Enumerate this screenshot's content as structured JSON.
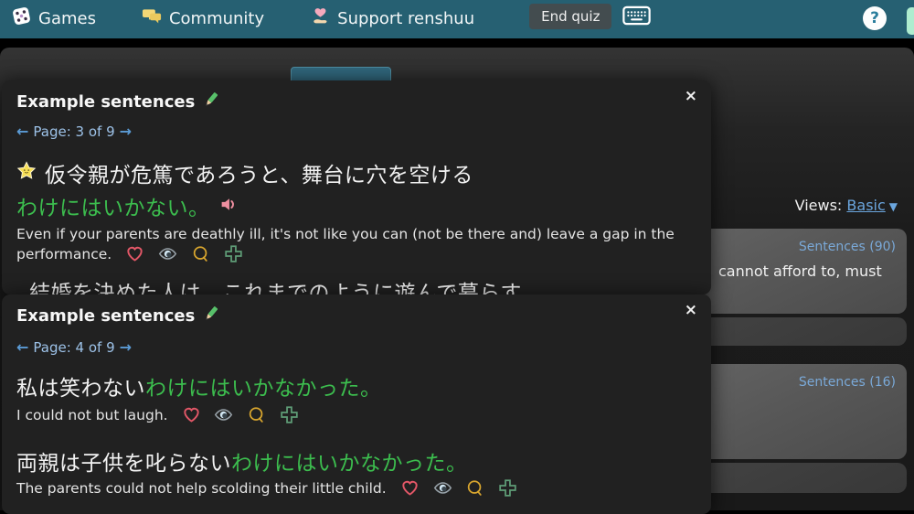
{
  "topbar": {
    "games": "Games",
    "community": "Community",
    "support": "Support renshuu",
    "end_quiz": "End quiz",
    "help": "?"
  },
  "modal1": {
    "title": "Example sentences",
    "close": "×",
    "prev_arrow": "←",
    "next_arrow": "→",
    "page": "Page: 3 of 9",
    "s1_jp_white": "仮令親が危篤であろうと、舞台に穴を空ける",
    "s1_jp_green": "わけにはいかない。",
    "s1_en": "Even if your parents are deathly ill, it's not like you can (not be there and) leave a gap in the performance.",
    "s2_jp_partial": "結婚を決めた人は、これまでのように遊んで暮らす"
  },
  "modal2": {
    "title": "Example sentences",
    "close": "×",
    "prev_arrow": "←",
    "next_arrow": "→",
    "page": "Page: 4 of 9",
    "s1_jp_white": "私は笑わない",
    "s1_jp_green": "わけにはいかなかった。",
    "s1_en": "I could not but laugh.",
    "s2_jp_white": "両親は子供を叱らない",
    "s2_jp_green": "わけにはいかなかった。",
    "s2_en": "The parents could not help scolding their little child."
  },
  "sidebar": {
    "views_label": "Views:",
    "views_value": "Basic",
    "card1_badge": "Sentences (90)",
    "card1_text": "cannot afford to, must",
    "card2_badge": "Sentences (16)"
  },
  "colors": {
    "topbar_teal": "#266072",
    "highlight_green": "#3cbd4e",
    "link_blue": "#7aa9d8",
    "heart_red": "#e25767",
    "bubble_gold": "#d9a62e",
    "plus_green": "#5f9d77",
    "speaker_pink": "#ee8fa0"
  }
}
